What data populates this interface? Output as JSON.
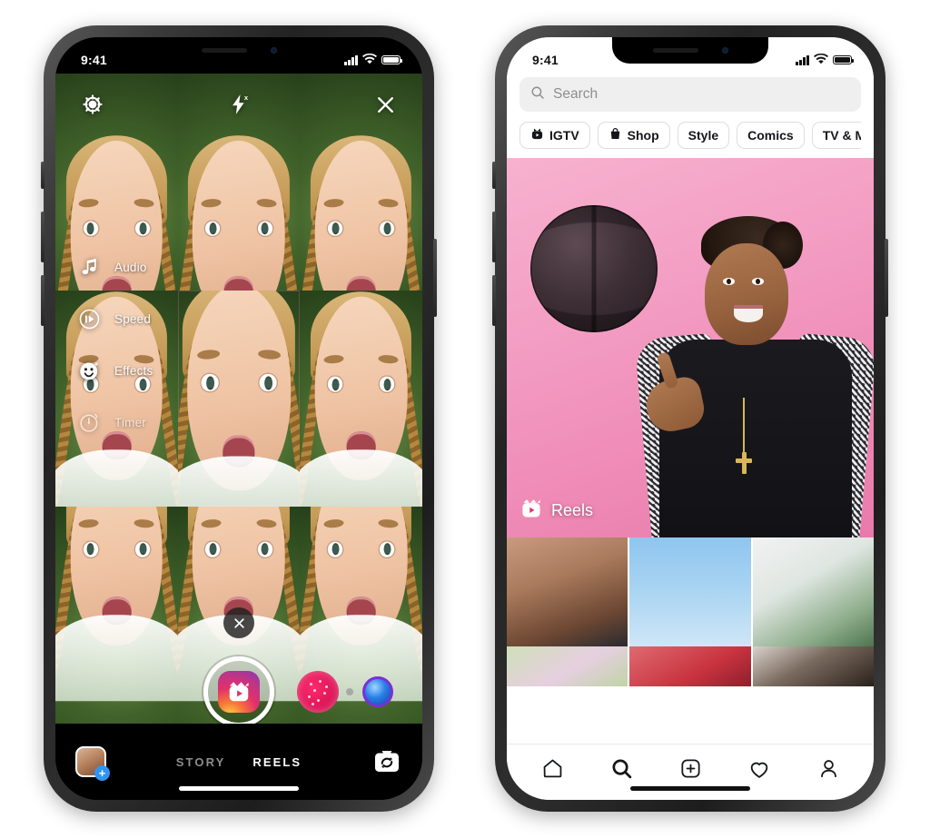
{
  "left_phone": {
    "status_bar": {
      "time": "9:41",
      "cellular_icon": "signal-bars-icon",
      "wifi_icon": "wifi-icon",
      "battery_icon": "battery-icon"
    },
    "camera": {
      "top_controls": [
        {
          "name": "settings-gear-icon",
          "label": "Settings"
        },
        {
          "name": "flash-off-icon",
          "label": "Flash Off"
        },
        {
          "name": "close-icon",
          "label": "Close"
        }
      ],
      "tools": [
        {
          "label": "Audio",
          "icon": "music-note-icon"
        },
        {
          "label": "Speed",
          "icon": "speed-icon"
        },
        {
          "label": "Effects",
          "icon": "smiley-sparkle-icon"
        },
        {
          "label": "Timer",
          "icon": "timer-icon"
        }
      ],
      "clear_effect_icon": "close-icon",
      "shutter": {
        "name": "reels-capture-button",
        "icon": "reels-clapper-icon"
      },
      "effects_carousel": [
        {
          "name": "hearts-effect",
          "color": "#e1135c"
        },
        {
          "name": "orb-effect",
          "color": "#2b7fe8"
        }
      ],
      "gallery": {
        "name": "gallery-thumbnail",
        "badge": "+"
      },
      "modes": [
        {
          "label": "STORY",
          "active": false
        },
        {
          "label": "REELS",
          "active": true
        }
      ],
      "flip_camera_icon": "flip-camera-icon"
    }
  },
  "right_phone": {
    "status_bar": {
      "time": "9:41",
      "cellular_icon": "signal-bars-icon",
      "wifi_icon": "wifi-icon",
      "battery_icon": "battery-icon"
    },
    "explore": {
      "search": {
        "placeholder": "Search",
        "icon": "search-icon"
      },
      "chips": [
        {
          "label": "IGTV",
          "icon": "igtv-icon"
        },
        {
          "label": "Shop",
          "icon": "shopping-bag-icon"
        },
        {
          "label": "Style",
          "icon": null
        },
        {
          "label": "Comics",
          "icon": null
        },
        {
          "label": "TV & Movie",
          "icon": null
        }
      ],
      "hero": {
        "badge_label": "Reels",
        "badge_icon": "reels-clapper-icon",
        "background_color": "#f39dc3"
      },
      "grid_row_1": [
        {
          "name": "grid-thumb-people-desk"
        },
        {
          "name": "grid-thumb-glitter-hand"
        },
        {
          "name": "grid-thumb-fashion-person"
        }
      ],
      "grid_row_2": [
        {
          "name": "grid-thumb-flowers"
        },
        {
          "name": "grid-thumb-red-fabric"
        },
        {
          "name": "grid-thumb-dark-portrait"
        }
      ],
      "nav": [
        {
          "name": "nav-home",
          "icon": "home-icon",
          "active": false
        },
        {
          "name": "nav-search",
          "icon": "search-icon",
          "active": true
        },
        {
          "name": "nav-create",
          "icon": "plus-box-icon",
          "active": false
        },
        {
          "name": "nav-activity",
          "icon": "heart-icon",
          "active": false
        },
        {
          "name": "nav-profile",
          "icon": "person-icon",
          "active": false
        }
      ]
    }
  }
}
